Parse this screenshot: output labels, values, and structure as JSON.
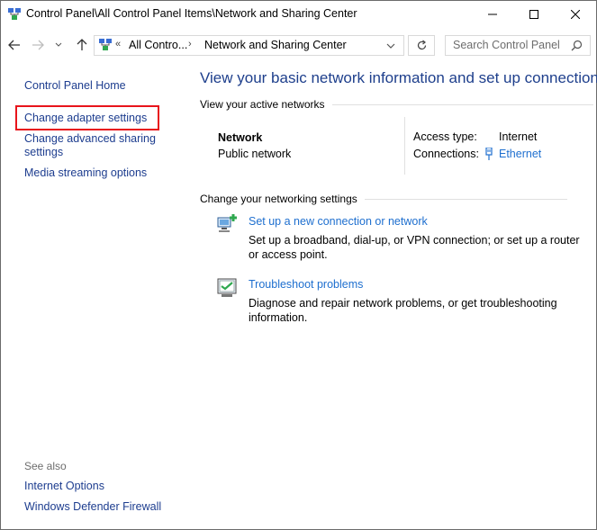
{
  "window": {
    "title": "Control Panel\\All Control Panel Items\\Network and Sharing Center"
  },
  "navbar": {
    "address": {
      "crumb1": "All Contro...",
      "crumb2": "Network and Sharing Center"
    },
    "search_placeholder": "Search Control Panel"
  },
  "sidebar": {
    "home": "Control Panel Home",
    "links": [
      "Change adapter settings",
      "Change advanced sharing settings",
      "Media streaming options"
    ],
    "see_also_heading": "See also",
    "see_also": [
      "Internet Options",
      "Windows Defender Firewall"
    ],
    "highlight_color": "#e8141b"
  },
  "main": {
    "title": "View your basic network information and set up connections",
    "active_networks_heading": "View your active networks",
    "network": {
      "name": "Network",
      "category": "Public network",
      "access_type_label": "Access type:",
      "access_type_value": "Internet",
      "connections_label": "Connections:",
      "connections_value": "Ethernet"
    },
    "change_settings_heading": "Change your networking settings",
    "tasks": [
      {
        "icon": "new-connection-icon",
        "title": "Set up a new connection or network",
        "description": "Set up a broadband, dial-up, or VPN connection; or set up a router or access point."
      },
      {
        "icon": "troubleshoot-icon",
        "title": "Troubleshoot problems",
        "description": "Diagnose and repair network problems, or get troubleshooting information."
      }
    ]
  },
  "colors": {
    "link": "#1d3d8f",
    "accent_link": "#1e6fcf",
    "title": "#1e3f8c"
  }
}
